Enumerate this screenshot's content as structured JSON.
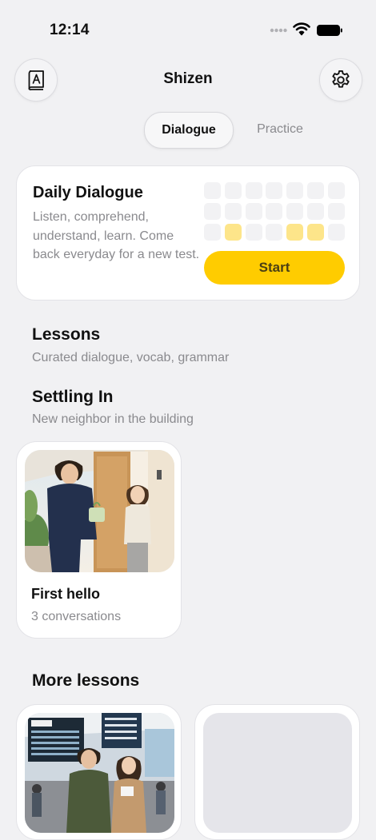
{
  "status_bar": {
    "time": "12:14"
  },
  "header": {
    "title": "Shizen",
    "dictionary_icon": "book-a-icon",
    "settings_icon": "gear-icon"
  },
  "tabs": [
    {
      "label": "Dialogue",
      "active": true
    },
    {
      "label": "Practice",
      "active": false
    }
  ],
  "daily_dialogue": {
    "title": "Daily Dialogue",
    "description": "Listen, comprehend, understand, learn. Come back everyday for a new test.",
    "start_label": "Start",
    "grid_rows": 3,
    "grid_cols": 7,
    "highlighted_cells": [
      15,
      18,
      19
    ],
    "accent_color": "#ffcc00",
    "highlight_color": "#fde58a"
  },
  "lessons": {
    "title": "Lessons",
    "subtitle": "Curated dialogue, vocab, grammar"
  },
  "settling_in": {
    "title": "Settling In",
    "subtitle": "New neighbor in the building",
    "cards": [
      {
        "title": "First hello",
        "subtitle": "3 conversations",
        "image": "neighbors-at-apartment-door"
      }
    ]
  },
  "more_lessons": {
    "title": "More lessons",
    "cards": [
      {
        "image": "travelers-at-airport-departure-board"
      },
      {
        "image": "placeholder"
      }
    ]
  }
}
